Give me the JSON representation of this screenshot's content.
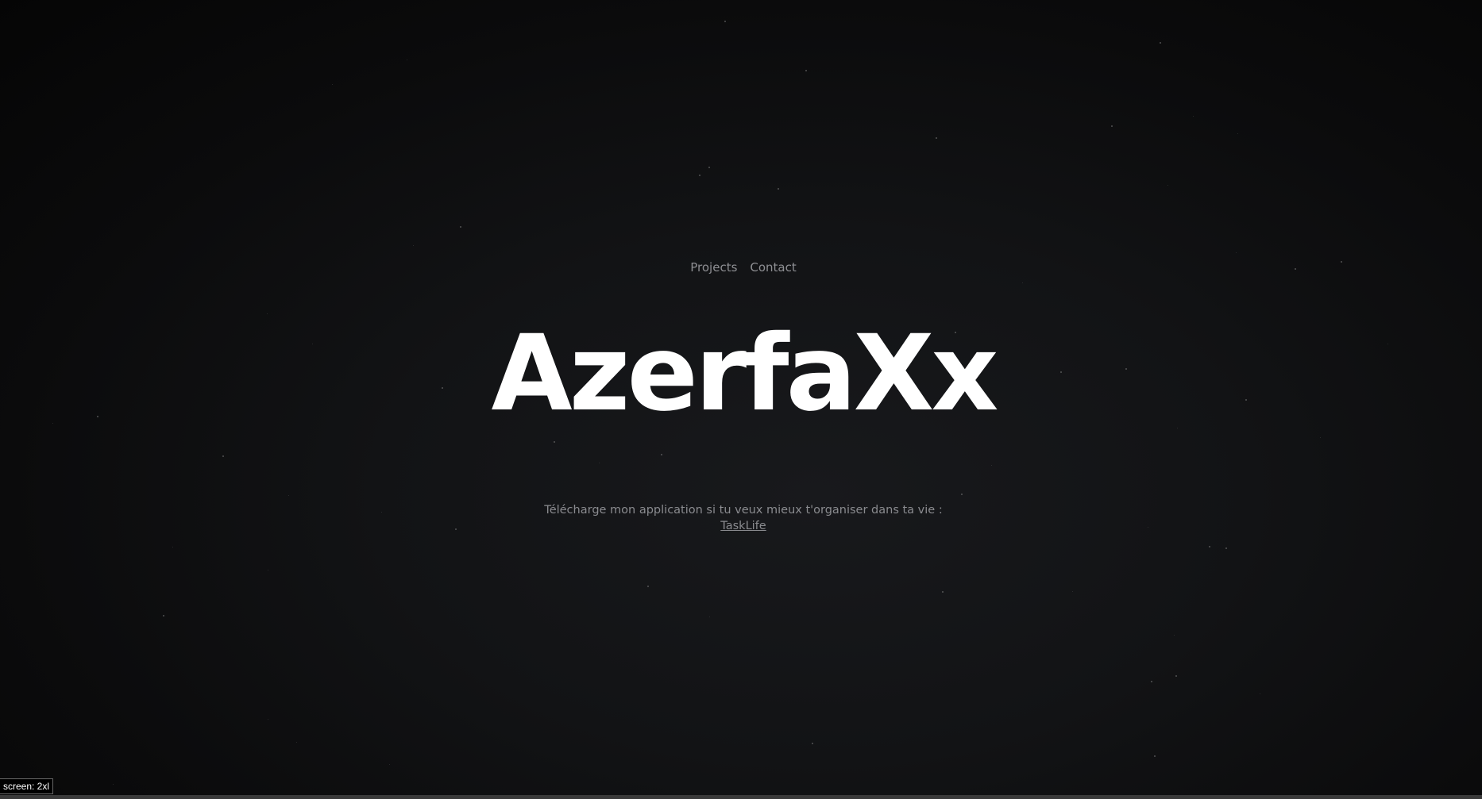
{
  "nav": {
    "items": [
      {
        "label": "Projects"
      },
      {
        "label": "Contact"
      }
    ]
  },
  "hero": {
    "title": "AzerfaXx"
  },
  "tagline": {
    "text": "Télécharge mon application si tu veux mieux t'organiser dans ta vie :",
    "link_label": "TaskLife"
  },
  "badge": {
    "text": "screen: 2xl"
  },
  "colors": {
    "background": "#121315",
    "title": "#ffffff",
    "muted_text": "#8a8b8f"
  }
}
